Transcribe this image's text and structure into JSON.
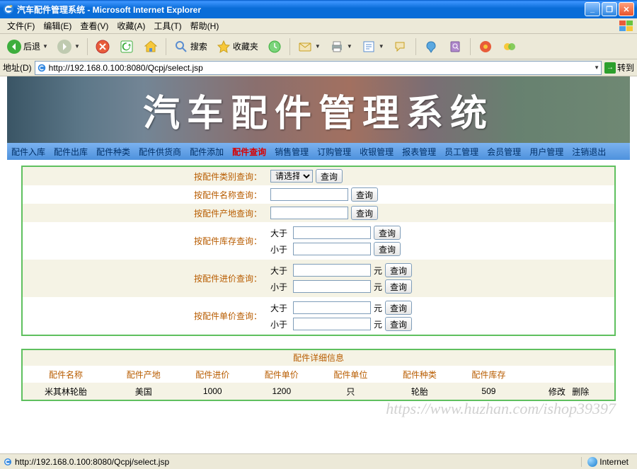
{
  "window": {
    "title": "汽车配件管理系统 - Microsoft Internet Explorer"
  },
  "menubar": {
    "items": [
      "文件(F)",
      "编辑(E)",
      "查看(V)",
      "收藏(A)",
      "工具(T)",
      "帮助(H)"
    ]
  },
  "toolbar": {
    "back": "后退",
    "search": "搜索",
    "favorites": "收藏夹"
  },
  "addressbar": {
    "label": "地址(D)",
    "url": "http://192.168.0.100:8080/Qcpj/select.jsp",
    "go": "转到"
  },
  "banner": {
    "title": "汽车配件管理系统"
  },
  "nav": {
    "items": [
      "配件入库",
      "配件出库",
      "配件种类",
      "配件供货商",
      "配件添加",
      "配件查询",
      "销售管理",
      "订购管理",
      "收银管理",
      "报表管理",
      "员工管理",
      "会员管理",
      "用户管理",
      "注销退出"
    ],
    "activeIndex": 5
  },
  "query": {
    "label_category": "按配件类别查询：",
    "label_name": "按配件名称查询：",
    "label_origin": "按配件产地查询：",
    "label_stock": "按配件库存查询：",
    "label_inprice": "按配件进价查询：",
    "label_unitprice": "按配件单价查询：",
    "select_placeholder": "请选择",
    "btn": "查询",
    "gt": "大于",
    "lt": "小于",
    "yuan": "元"
  },
  "detail": {
    "title": "配件详细信息",
    "headers": [
      "配件名称",
      "配件产地",
      "配件进价",
      "配件单价",
      "配件单位",
      "配件种类",
      "配件库存",
      ""
    ],
    "row": {
      "name": "米其林轮胎",
      "origin": "美国",
      "inprice": "1000",
      "unitprice": "1200",
      "unit": "只",
      "category": "轮胎",
      "stock": "509",
      "edit": "修改",
      "delete": "删除"
    }
  },
  "watermark": "https://www.huzhan.com/ishop39397",
  "statusbar": {
    "text": "http://192.168.0.100:8080/Qcpj/select.jsp",
    "zone": "Internet"
  }
}
